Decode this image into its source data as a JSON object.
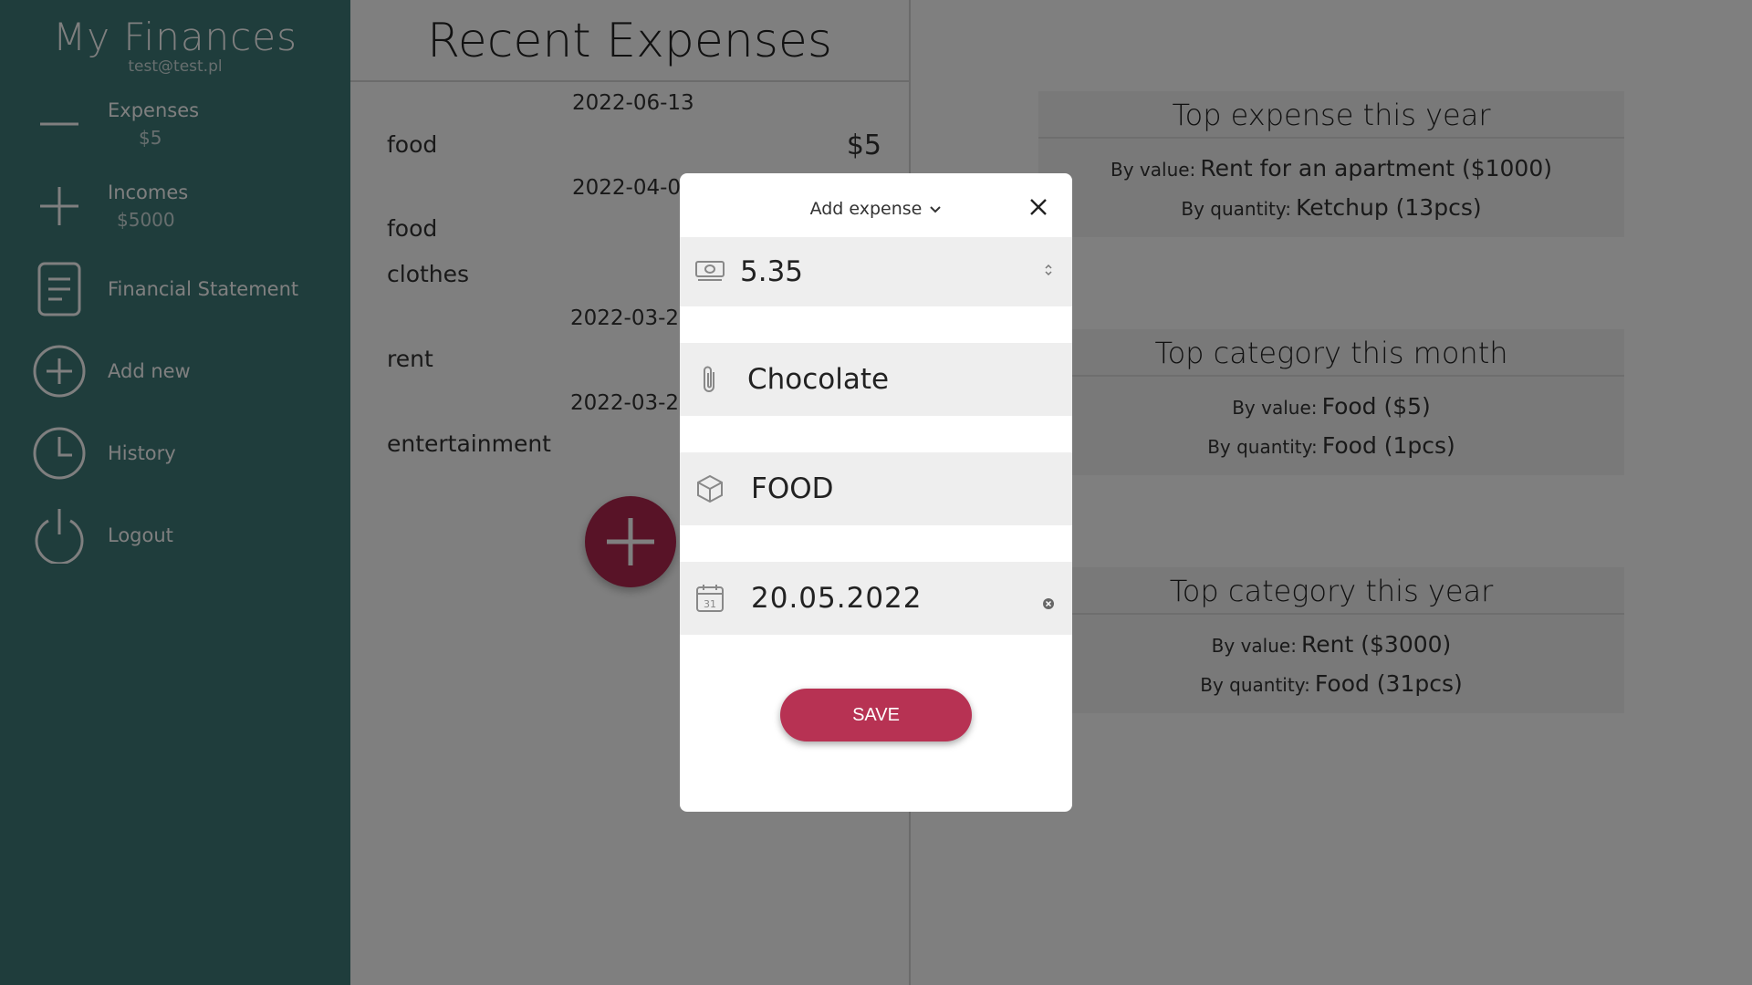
{
  "app": {
    "title": "My Finances",
    "email": "test@test.pl"
  },
  "sidebar": {
    "items": [
      {
        "label": "Expenses",
        "sub": "$5",
        "icon": "minus-icon"
      },
      {
        "label": "Incomes",
        "sub": "$5000",
        "icon": "plus-icon"
      },
      {
        "label": "Financial Statement",
        "sub": "",
        "icon": "document-icon"
      },
      {
        "label": "Add new",
        "sub": "",
        "icon": "add-circle-icon"
      },
      {
        "label": "History",
        "sub": "",
        "icon": "clock-icon"
      },
      {
        "label": "Logout",
        "sub": "",
        "icon": "power-icon"
      }
    ]
  },
  "recent": {
    "title": "Recent Expenses",
    "groups": [
      {
        "date": "2022-06-13",
        "items": [
          {
            "category": "food",
            "amount": "$5"
          }
        ]
      },
      {
        "date": "2022-04-0",
        "items": [
          {
            "category": "food",
            "amount": ""
          },
          {
            "category": "clothes",
            "amount": ""
          }
        ]
      },
      {
        "date": "2022-03-2",
        "items": [
          {
            "category": "rent",
            "amount": ""
          }
        ]
      },
      {
        "date": "2022-03-2",
        "items": [
          {
            "category": "entertainment",
            "amount": ""
          }
        ]
      }
    ]
  },
  "stats": {
    "cards": [
      {
        "title": "Top expense this year",
        "by_value_label": "By value:",
        "by_value": "Rent for an apartment ($1000)",
        "by_quantity_label": "By quantity:",
        "by_quantity": "Ketchup (13pcs)"
      },
      {
        "title": "Top category this month",
        "by_value_label": "By value:",
        "by_value": "Food ($5)",
        "by_quantity_label": "By quantity:",
        "by_quantity": "Food (1pcs)"
      },
      {
        "title": "Top category this year",
        "by_value_label": "By value:",
        "by_value": "Rent ($3000)",
        "by_quantity_label": "By quantity:",
        "by_quantity": "Food (31pcs)"
      }
    ]
  },
  "modal": {
    "title": "Add expense",
    "amount": "5.35",
    "name": "Chocolate",
    "category": "FOOD",
    "date": "20.05.2022",
    "save_label": "SAVE",
    "calendar_day": "31"
  },
  "colors": {
    "sidebar": "#3e7a79",
    "accent": "#b73253",
    "fab": "#b0264e"
  }
}
